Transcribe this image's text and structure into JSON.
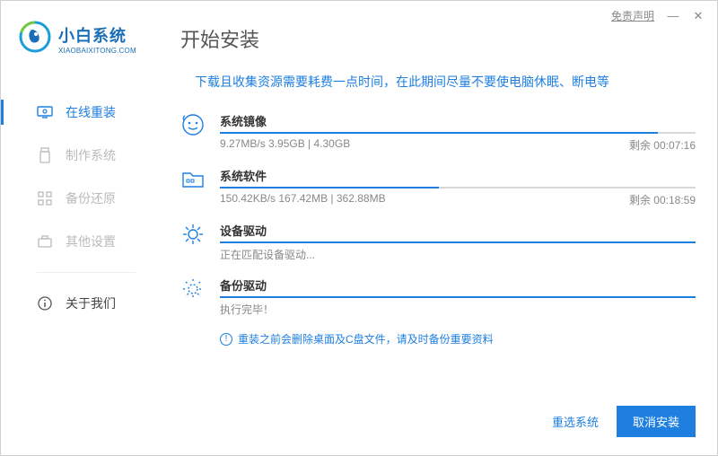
{
  "titlebar": {
    "disclaimer": "免责声明"
  },
  "logo": {
    "cn": "小白系统",
    "en": "XIAOBAIXITONG.COM"
  },
  "sidebar": {
    "items": [
      {
        "label": "在线重装"
      },
      {
        "label": "制作系统"
      },
      {
        "label": "备份还原"
      },
      {
        "label": "其他设置"
      },
      {
        "label": "关于我们"
      }
    ]
  },
  "page": {
    "title": "开始安装",
    "notice": "下载且收集资源需要耗费一点时间，在此期间尽量不要使电脑休眠、断电等"
  },
  "tasks": [
    {
      "title": "系统镜像",
      "meta": "9.27MB/s 3.95GB | 4.30GB",
      "remain": "剩余 00:07:16",
      "progress": 92
    },
    {
      "title": "系统软件",
      "meta": "150.42KB/s 167.42MB | 362.88MB",
      "remain": "剩余 00:18:59",
      "progress": 46
    },
    {
      "title": "设备驱动",
      "status": "正在匹配设备驱动...",
      "progress": 100
    },
    {
      "title": "备份驱动",
      "status": "执行完毕！",
      "progress": 100
    }
  ],
  "warning": "重装之前会删除桌面及C盘文件，请及时备份重要资料",
  "footer": {
    "reselect": "重选系统",
    "cancel": "取消安装"
  }
}
